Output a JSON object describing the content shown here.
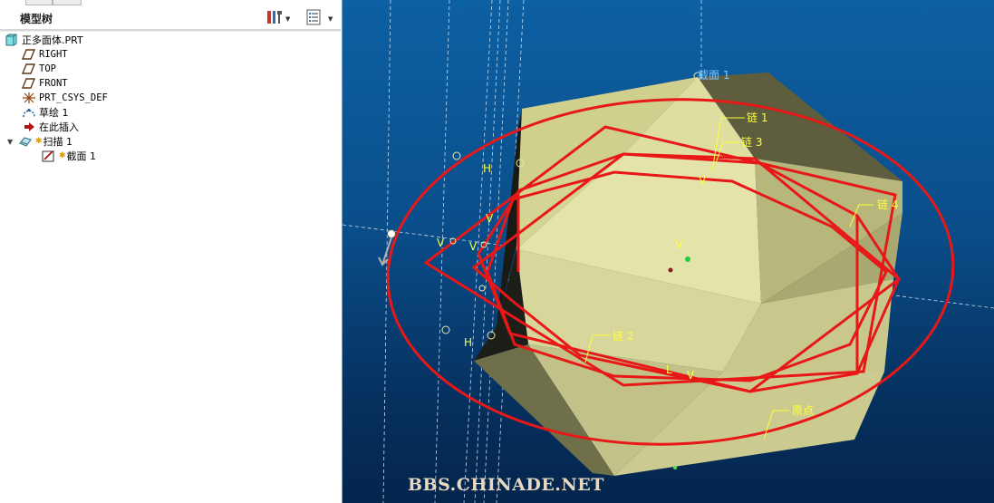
{
  "panel": {
    "title": "模型树",
    "tools_icon": "tree-settings-icon",
    "filter_icon": "tree-filter-icon"
  },
  "tree": {
    "items": [
      {
        "label": "正多面体.PRT",
        "icon": "part-icon"
      },
      {
        "label": "RIGHT",
        "icon": "datum-plane-icon"
      },
      {
        "label": "TOP",
        "icon": "datum-plane-icon"
      },
      {
        "label": "FRONT",
        "icon": "datum-plane-icon"
      },
      {
        "label": "PRT_CSYS_DEF",
        "icon": "csys-icon"
      },
      {
        "label": "草绘 1",
        "icon": "sketch-icon"
      },
      {
        "label": "在此插入",
        "icon": "insert-here-arrow-icon"
      },
      {
        "label": "扫描 1",
        "icon": "sweep-feature-icon"
      },
      {
        "label": "截面 1",
        "icon": "section-icon"
      }
    ]
  },
  "viewport": {
    "labels": {
      "section": "截面 1",
      "chain1": "链 1",
      "chain3": "链 3",
      "chain4": "链 4",
      "chain2": "链 2",
      "origin": "原点",
      "h_top": "H",
      "h_bottom": "H",
      "v_main": "V",
      "v_left_1": "V",
      "v_left_2": "V",
      "v_left_3": "V",
      "v_top": "V",
      "v_lower": "V",
      "l_lower": "L"
    },
    "watermark": "BBS.CHINADE.NET",
    "colors": {
      "background": "#0a4e8a",
      "solid_face": "#d9d99a",
      "trajectory": "#e81818",
      "annotation": "#ffff3a",
      "section_label": "#7ec8ff"
    }
  }
}
